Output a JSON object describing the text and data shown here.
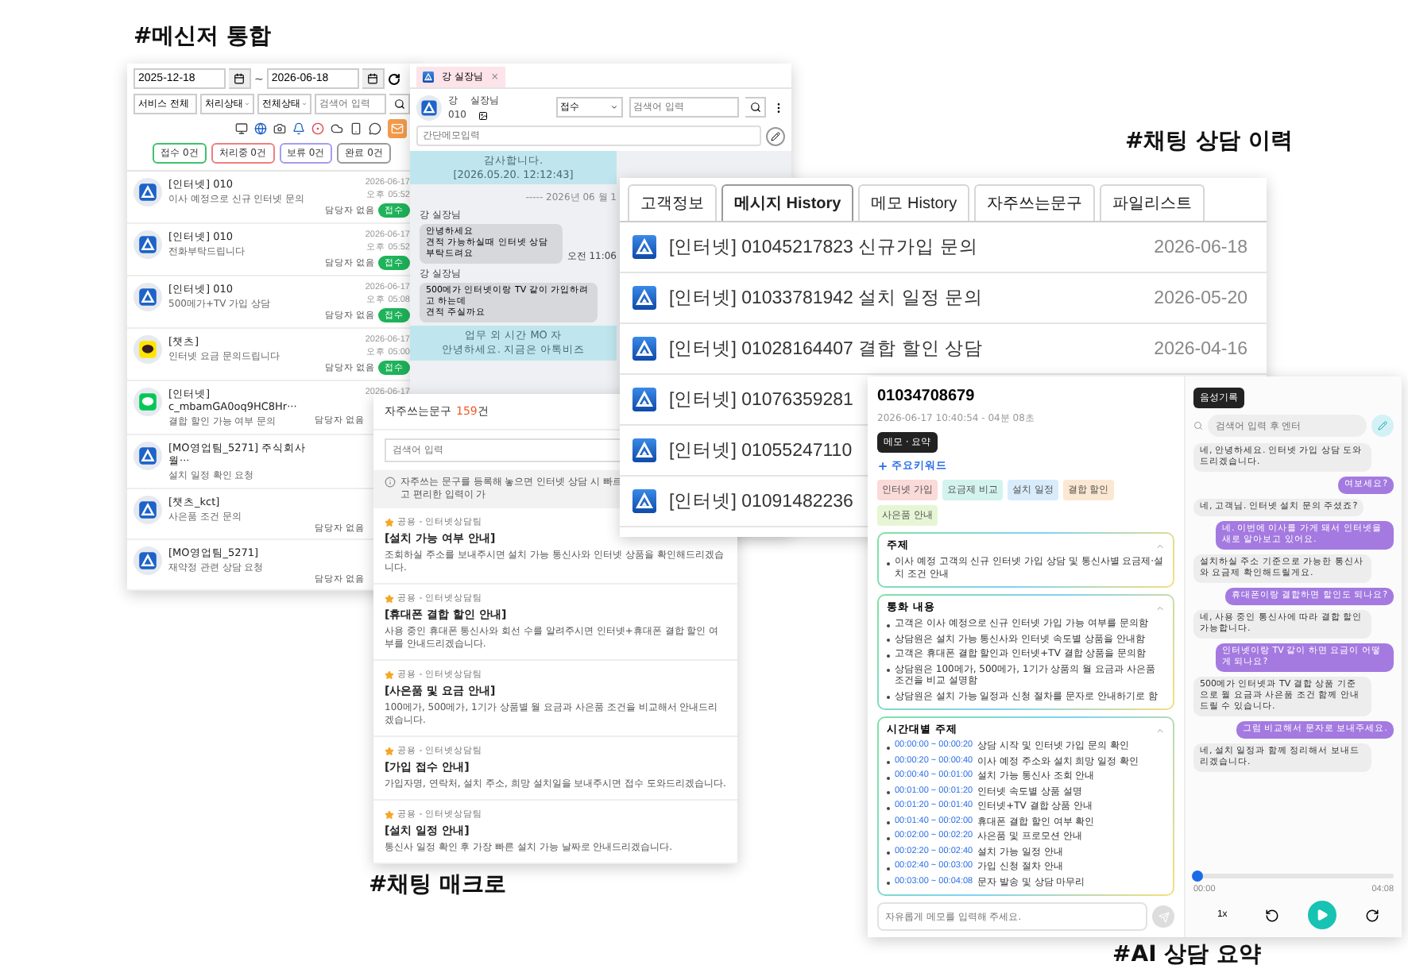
{
  "messenger": {
    "caption": "#메신저 통합",
    "date_from": "2025-12-18",
    "date_sep": "~",
    "date_to": "2026-06-18",
    "filters": [
      "서비스 전체",
      "처리상태",
      "전체상태"
    ],
    "search": {
      "placeholder": "검색어 입력"
    },
    "status_buttons": [
      {
        "label": "접수 0건",
        "color": "#3cc36b"
      },
      {
        "label": "처리중 0건",
        "color": "#f07f7f"
      },
      {
        "label": "보류 0건",
        "color": "#a59cf0"
      },
      {
        "label": "완료 0건",
        "color": "#9a9a9a"
      }
    ],
    "items": [
      {
        "kind": "internet",
        "title": "[인터넷] 010",
        "message": "이사 예정으로 신규 인터넷 문의",
        "date": "2026-06-17",
        "time": "오후 05:52",
        "assignee": "담당자 없음",
        "status": "접수"
      },
      {
        "kind": "internet",
        "title": "[인터넷] 010",
        "message": "전화부탁드립니다",
        "date": "2026-06-17",
        "time": "오후 05:52",
        "assignee": "담당자 없음",
        "status": "접수"
      },
      {
        "kind": "internet",
        "title": "[인터넷] 010",
        "message": "500메가+TV 가입 상담",
        "date": "2026-06-17",
        "time": "오후 05:08",
        "assignee": "담당자 없음",
        "status": "접수"
      },
      {
        "kind": "kakao",
        "title": "[챗츠]",
        "message": "인터넷 요금 문의드립니다",
        "date": "2026-06-17",
        "time": "오후 05:00",
        "assignee": "담당자 없음",
        "status": "접수"
      },
      {
        "kind": "line",
        "title": "[인터넷] c_mbamGA0oq9HC8Hr···",
        "message": "결합 할인 가능 여부 문의",
        "date": "2026-06-17",
        "assignee": "담당자 없음"
      },
      {
        "kind": "internet",
        "title": "[MO영업팀_5271] 주식회사 월···",
        "message": "설치 일정 확인 요청"
      },
      {
        "kind": "internet",
        "title": "[챗츠_kct]",
        "message": "사은품 조건 문의",
        "assignee": "담당자 없음"
      },
      {
        "kind": "internet",
        "title": "[MO영업팀_5271]",
        "message": "재약정 관련 상담 요청",
        "assignee": "담당자 없음"
      }
    ]
  },
  "chat": {
    "tab": {
      "name": "강",
      "role": "실장님",
      "close": "×"
    },
    "customer": {
      "name": "강",
      "role": "실장님",
      "phone": "010"
    },
    "status_select": "접수",
    "search": {
      "placeholder": "검색어 입력"
    },
    "memo": {
      "placeholder": "간단메모입력"
    },
    "messages": [
      {
        "kind": "system",
        "lines": [
          "감사합니다.",
          "[2026.05.20. 12:12:43]"
        ]
      },
      {
        "kind": "divider",
        "text": "----- 2026년 06 월 1"
      },
      {
        "kind": "customer",
        "sender": "강",
        "role": "실장님",
        "lines": [
          "안녕하세요",
          "견적 가능하실때 인터넷 상담 부탁드려요"
        ],
        "time": "오전 11:06"
      },
      {
        "kind": "customer",
        "sender": "강",
        "role": "실장님",
        "lines": [
          "500메가 인터넷이랑 TV 같이 가입하려고 하는데",
          "견적 주실까요"
        ]
      },
      {
        "kind": "system",
        "lines": [
          "업무 외 시간 MO 자",
          "안녕하세요. 지금은 아톡비즈"
        ]
      }
    ]
  },
  "history": {
    "caption": "#채팅 상담 이력",
    "tabs": [
      {
        "label": "고객정보",
        "selected": false
      },
      {
        "label": "메시지 History",
        "selected": true
      },
      {
        "label": "메모 History",
        "selected": false
      },
      {
        "label": "자주쓰는문구",
        "selected": false
      },
      {
        "label": "파일리스트",
        "selected": false
      }
    ],
    "rows": [
      {
        "title": "[인터넷] 01045217823 신규가입 문의",
        "date": "2026-06-18"
      },
      {
        "title": "[인터넷] 01033781942 설치 일정 문의",
        "date": "2026-05-20"
      },
      {
        "title": "[인터넷] 01028164407 결합 할인 상담",
        "date": "2026-04-16"
      },
      {
        "title": "[인터넷] 01076359281"
      },
      {
        "title": "[인터넷] 01055247110"
      },
      {
        "title": "[인터넷] 01091482236"
      }
    ]
  },
  "macro": {
    "caption": "#채팅 매크로",
    "title": "자주쓰는문구",
    "count": "159",
    "count_unit": "건",
    "search": {
      "placeholder": "검색어 입력"
    },
    "info": "자주쓰는 문구를 등록해 놓으면 인터넷 상담 시 빠르고 편리한 입력이 가",
    "items": [
      {
        "tag": "공용 - 인터넷상담팀",
        "title": "[설치 가능 여부 안내]",
        "text": "조회하실 주소를 보내주시면 설치 가능 통신사와 인터넷 상품을 확인해드리겠습니다."
      },
      {
        "tag": "공용 - 인터넷상담팀",
        "title": "[휴대폰 결합 할인 안내]",
        "text": "사용 중인 휴대폰 통신사와 회선 수를 알려주시면 인터넷+휴대폰 결합 할인 여부를 안내드리겠습니다."
      },
      {
        "tag": "공용 - 인터넷상담팀",
        "title": "[사은품 및 요금 안내]",
        "text": "100메가, 500메가, 1기가 상품별 월 요금과 사은품 조건을 비교해서 안내드리겠습니다."
      },
      {
        "tag": "공용 - 인터넷상담팀",
        "title": "[가입 접수 안내]",
        "text": "가입자명, 연락처, 설치 주소, 희망 설치일을 보내주시면 접수 도와드리겠습니다."
      },
      {
        "tag": "공용 - 인터넷상담팀",
        "title": "[설치 일정 안내]",
        "text": "통신사 일정 확인 후 가장 빠른 설치 가능 날짜로 안내드리겠습니다."
      }
    ]
  },
  "ai_summary": {
    "caption": "#AI 상담 요약",
    "phone": "01034708679",
    "datetime": "2026-06-17 10:40:54 - 04분 08초",
    "memo_badge": "메모 · 요약",
    "keyword_label": "주요키워드",
    "keywords": [
      {
        "label": "인터넷 가입",
        "color": "#fbdada"
      },
      {
        "label": "요금제 비교",
        "color": "#d3f3ee"
      },
      {
        "label": "설치 일정",
        "color": "#d8ecfb"
      },
      {
        "label": "결합 할인",
        "color": "#fce8d2"
      },
      {
        "label": "사은품 안내",
        "color": "#e6f6d5"
      }
    ],
    "sections": [
      {
        "kind": "bullets",
        "title": "주제",
        "items": [
          "이사 예정 고객의 신규 인터넷 가입 상담 및 통신사별 요금제·설치 조건 안내"
        ]
      },
      {
        "kind": "bullets",
        "title": "통화 내용",
        "items": [
          "고객은 이사 예정으로 신규 인터넷 가입 가능 여부를 문의함",
          "상담원은 설치 가능 통신사와 인터넷 속도별 상품을 안내함",
          "고객은 휴대폰 결합 할인과 인터넷+TV 결합 상품을 문의함",
          "상담원은 100메가, 500메가, 1기가 상품의 월 요금과 사은품 조건을 비교 설명함",
          "상담원은 설치 가능 일정과 신청 절차를 문자로 안내하기로 함"
        ]
      },
      {
        "kind": "timeline",
        "title": "시간대별 주제",
        "items": [
          {
            "time": "00:00:00 ~ 00:00:20",
            "text": "상담 시작 및 인터넷 가입 문의 확인"
          },
          {
            "time": "00:00:20 ~ 00:00:40",
            "text": "이사 예정 주소와 설치 희망 일정 확인"
          },
          {
            "time": "00:00:40 ~ 00:01:00",
            "text": "설치 가능 통신사 조회 안내"
          },
          {
            "time": "00:01:00 ~ 00:01:20",
            "text": "인터넷 속도별 상품 설명"
          },
          {
            "time": "00:01:20 ~ 00:01:40",
            "text": "인터넷+TV 결합 상품 안내"
          },
          {
            "time": "00:01:40 ~ 00:02:00",
            "text": "휴대폰 결합 할인 여부 확인"
          },
          {
            "time": "00:02:00 ~ 00:02:20",
            "text": "사은품 및 프로모션 안내"
          },
          {
            "time": "00:02:20 ~ 00:02:40",
            "text": "설치 가능 일정 안내"
          },
          {
            "time": "00:02:40 ~ 00:03:00",
            "text": "가입 신청 절차 안내"
          },
          {
            "time": "00:03:00 ~ 00:04:08",
            "text": "문자 발송 및 상담 마무리"
          }
        ]
      }
    ],
    "memo": {
      "placeholder": "자유롭게 메모를 입력해 주세요."
    },
    "voice_badge": "음성기록",
    "voice_search": {
      "placeholder": "검색어 입력 후 엔터"
    },
    "transcript": [
      {
        "kind": "agent",
        "text": "네, 안녕하세요. 인터넷 가입 상담 도와드리겠습니다."
      },
      {
        "kind": "customer",
        "text": "여보세요?"
      },
      {
        "kind": "agent",
        "text": "네, 고객님. 인터넷 설치 문의 주셨죠?"
      },
      {
        "kind": "customer",
        "text": "네. 이번에 이사를 가게 돼서 인터넷을 새로 알아보고 있어요."
      },
      {
        "kind": "agent",
        "text": "설치하실 주소 기준으로 가능한 통신사와 요금제 확인해드릴게요."
      },
      {
        "kind": "customer",
        "text": "휴대폰이랑 결합하면 할인도 되나요?"
      },
      {
        "kind": "agent",
        "text": "네, 사용 중인 통신사에 따라 결합 할인 가능합니다."
      },
      {
        "kind": "customer",
        "text": "인터넷이랑 TV 같이 하면 요금이 어떻게 되나요?"
      },
      {
        "kind": "agent",
        "text": "500메가 인터넷과 TV 결합 상품 기준으로 월 요금과 사은품 조건 함께 안내드릴 수 있습니다."
      },
      {
        "kind": "customer",
        "text": "그럼 비교해서 문자로 보내주세요."
      },
      {
        "kind": "agent",
        "text": "네, 설치 일정과 함께 정리해서 보내드리겠습니다."
      }
    ],
    "player": {
      "level": 0,
      "elapsed": "00:00",
      "total": "04:08",
      "speed": "1x"
    }
  }
}
